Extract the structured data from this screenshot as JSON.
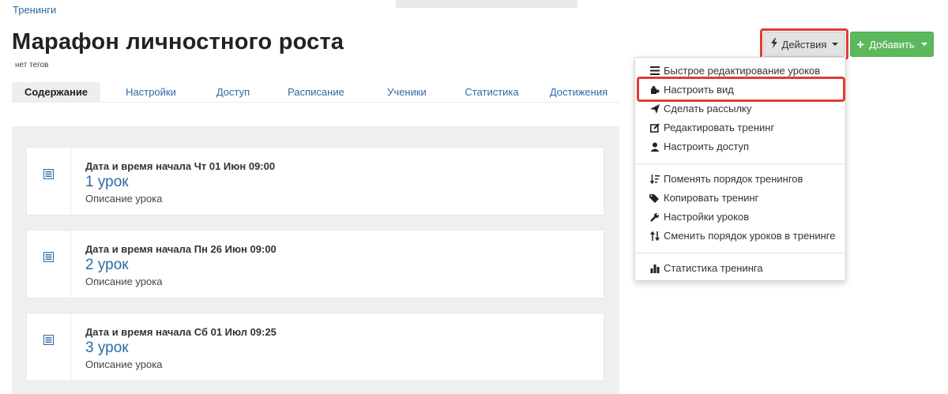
{
  "breadcrumb": "Тренинги",
  "title": "Марафон личностного роста",
  "tags": "нет тегов",
  "buttons": {
    "actions_label": "Действия",
    "add_label": "Добавить"
  },
  "tabs": [
    {
      "label": "Содержание",
      "active": true
    },
    {
      "label": "Настройки"
    },
    {
      "label": "Доступ"
    },
    {
      "label": "Расписание"
    },
    {
      "label": "Ученики"
    },
    {
      "label": "Статистика"
    },
    {
      "label": "Достижения"
    }
  ],
  "lessons": [
    {
      "date": "Дата и время начала Чт 01 Июн 09:00",
      "title": "1 урок",
      "description": "Описание урока"
    },
    {
      "date": "Дата и время начала Пн 26 Июн 09:00",
      "title": "2 урок",
      "description": "Описание урока"
    },
    {
      "date": "Дата и время начала Сб 01 Июл 09:25",
      "title": "3 урок",
      "description": "Описание урока"
    }
  ],
  "menu": {
    "items": [
      {
        "label": "Быстрое редактирование уроков",
        "icon": "list-icon"
      },
      {
        "label": "Настроить вид",
        "icon": "puzzle-icon"
      },
      {
        "label": "Сделать рассылку",
        "icon": "send-icon"
      },
      {
        "label": "Редактировать тренинг",
        "icon": "edit-icon"
      },
      {
        "label": "Настроить доступ",
        "icon": "user-icon"
      },
      {
        "label": "Поменять порядок тренингов",
        "icon": "sort-icon"
      },
      {
        "label": "Копировать тренинг",
        "icon": "tags-icon"
      },
      {
        "label": "Настройки уроков",
        "icon": "wrench-icon"
      },
      {
        "label": "Сменить порядок уроков в тренинге",
        "icon": "sort-arrows-icon"
      },
      {
        "label": "Статистика тренинга",
        "icon": "bar-chart-icon"
      }
    ]
  },
  "colors": {
    "link": "#2b6aa6",
    "add_button": "#5cb85c",
    "highlight": "#e53935"
  }
}
